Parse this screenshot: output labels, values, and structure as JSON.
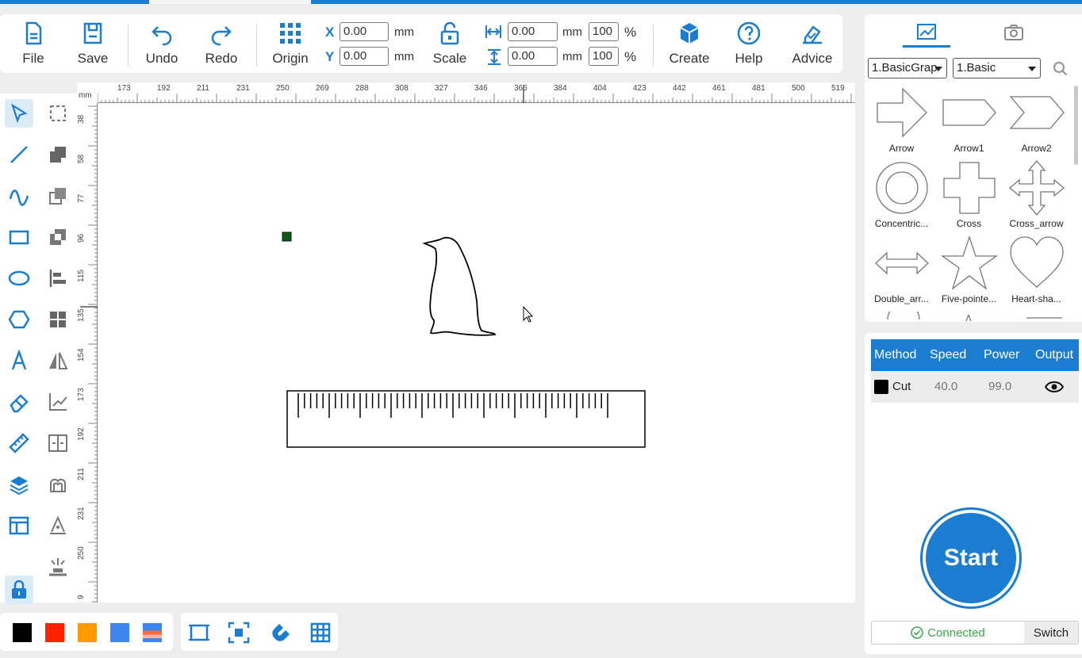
{
  "toolbar": {
    "file": "File",
    "save": "Save",
    "undo": "Undo",
    "redo": "Redo",
    "origin": "Origin",
    "scale": "Scale",
    "create": "Create",
    "help": "Help",
    "advice": "Advice",
    "x_label": "X",
    "y_label": "Y",
    "x_value": "0.00",
    "y_value": "0.00",
    "unit_mm": "mm",
    "width_value": "0.00",
    "height_value": "0.00",
    "width_pct": "100",
    "height_pct": "100",
    "pct": "%"
  },
  "ruler": {
    "unit": "mm",
    "h_ticks": [
      "173",
      "192",
      "211",
      "231",
      "250",
      "269",
      "288",
      "308",
      "327",
      "346",
      "365",
      "384",
      "404",
      "423",
      "442",
      "461",
      "481",
      "500",
      "519"
    ],
    "v_ticks": [
      "38",
      "58",
      "77",
      "96",
      "115",
      "135",
      "154",
      "173",
      "192",
      "211",
      "231",
      "250",
      "9"
    ]
  },
  "colors": {
    "accent": "#1a7dd0",
    "swatches": [
      "#000000",
      "#ff2200",
      "#ff9a00",
      "#3d86f0"
    ]
  },
  "library": {
    "category": "1.BasicGrap",
    "subcategory": "1.Basic",
    "shapes": [
      {
        "name": "Arrow"
      },
      {
        "name": "Arrow1"
      },
      {
        "name": "Arrow2"
      },
      {
        "name": "Concentric..."
      },
      {
        "name": "Cross"
      },
      {
        "name": "Cross_arrow"
      },
      {
        "name": "Double_arr..."
      },
      {
        "name": "Five-pointe..."
      },
      {
        "name": "Heart-sha..."
      }
    ]
  },
  "layers": {
    "headers": {
      "method": "Method",
      "speed": "Speed",
      "power": "Power",
      "output": "Output"
    },
    "rows": [
      {
        "color": "#000000",
        "method": "Cut",
        "speed": "40.0",
        "power": "99.0"
      }
    ]
  },
  "start": "Start",
  "connection": {
    "status": "Connected",
    "switch": "Switch"
  }
}
